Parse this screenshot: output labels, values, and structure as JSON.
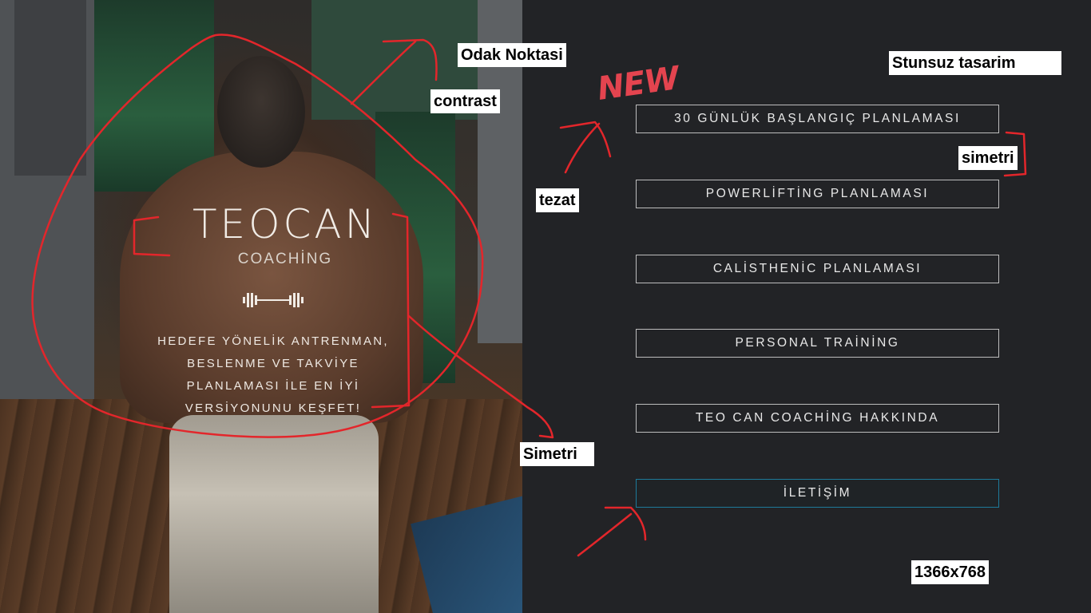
{
  "hero": {
    "brand_title": "TEOCAN",
    "brand_subtitle": "COACHİNG",
    "tagline_lines": [
      "HEDEFE YÖNELİK ANTRENMAN,",
      "BESLENME VE TAKVİYE",
      "PLANLAMASI İLE EN İYİ",
      "VERSİYONUNU KEŞFET!"
    ],
    "dumbbell_icon": "dumbbell-icon"
  },
  "menu": {
    "items": [
      "30 GÜNLÜK BAŞLANGIÇ PLANLAMASI",
      "POWERLİFTİNG PLANLAMASI",
      "CALİSTHENİC PLANLAMASI",
      "PERSONAL TRAİNİNG",
      "TEO CAN COACHİNG HAKKINDA",
      "İLETİŞİM"
    ],
    "accent_color": "#1e7a9a"
  },
  "annotations": {
    "new_label": "NEW",
    "odak_noktasi": "Odak Noktasi",
    "contrast": "contrast",
    "tezat": "tezat",
    "stunsuz_tasarim": "Stunsuz tasarim",
    "simetri_right": "simetri",
    "simetri_left": "Simetri",
    "resolution": "1366x768",
    "ink_color": "#e3262b"
  }
}
